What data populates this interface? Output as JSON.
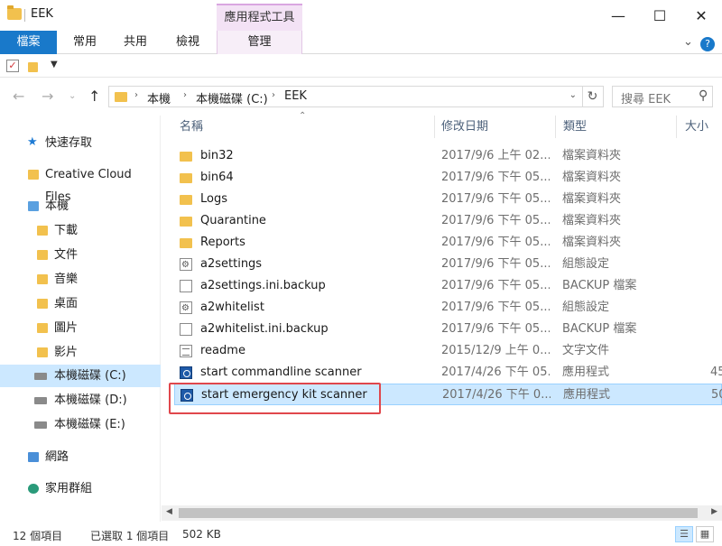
{
  "window": {
    "title": "EEK",
    "context_tools_label": "應用程式工具"
  },
  "ribbon": {
    "tabs": [
      "檔案",
      "常用",
      "共用",
      "檢視",
      "管理"
    ]
  },
  "address": {
    "crumbs": [
      "本機",
      "本機磁碟 (C:)",
      "EEK"
    ]
  },
  "search": {
    "placeholder": "搜尋 EEK"
  },
  "sidebar": {
    "items": [
      {
        "label": "快速存取",
        "icon": "star-icon"
      },
      {
        "label": "Creative Cloud Files",
        "icon": "creative-cloud-icon"
      },
      {
        "label": "本機",
        "icon": "computer-icon"
      },
      {
        "label": "下載",
        "icon": "downloads-icon"
      },
      {
        "label": "文件",
        "icon": "documents-icon"
      },
      {
        "label": "音樂",
        "icon": "music-icon"
      },
      {
        "label": "桌面",
        "icon": "desktop-icon"
      },
      {
        "label": "圖片",
        "icon": "pictures-icon"
      },
      {
        "label": "影片",
        "icon": "videos-icon"
      },
      {
        "label": "本機磁碟 (C:)",
        "icon": "drive-icon"
      },
      {
        "label": "本機磁碟 (D:)",
        "icon": "drive-icon"
      },
      {
        "label": "本機磁碟 (E:)",
        "icon": "drive-icon"
      },
      {
        "label": "網路",
        "icon": "network-icon"
      },
      {
        "label": "家用群組",
        "icon": "homegroup-icon"
      }
    ]
  },
  "columns": {
    "name": "名稱",
    "date": "修改日期",
    "type": "類型",
    "size": "大小"
  },
  "files": [
    {
      "name": "bin32",
      "date": "2017/9/6 上午 02...",
      "type": "檔案資料夾",
      "size": "",
      "icon": "folder"
    },
    {
      "name": "bin64",
      "date": "2017/9/6 下午 05...",
      "type": "檔案資料夾",
      "size": "",
      "icon": "folder"
    },
    {
      "name": "Logs",
      "date": "2017/9/6 下午 05...",
      "type": "檔案資料夾",
      "size": "",
      "icon": "folder"
    },
    {
      "name": "Quarantine",
      "date": "2017/9/6 下午 05...",
      "type": "檔案資料夾",
      "size": "",
      "icon": "folder"
    },
    {
      "name": "Reports",
      "date": "2017/9/6 下午 05...",
      "type": "檔案資料夾",
      "size": "",
      "icon": "folder"
    },
    {
      "name": "a2settings",
      "date": "2017/9/6 下午 05...",
      "type": "組態設定",
      "size": "",
      "icon": "cfg"
    },
    {
      "name": "a2settings.ini.backup",
      "date": "2017/9/6 下午 05...",
      "type": "BACKUP 檔案",
      "size": "",
      "icon": "file"
    },
    {
      "name": "a2whitelist",
      "date": "2017/9/6 下午 05...",
      "type": "組態設定",
      "size": "",
      "icon": "cfg"
    },
    {
      "name": "a2whitelist.ini.backup",
      "date": "2017/9/6 下午 05...",
      "type": "BACKUP 檔案",
      "size": "",
      "icon": "file"
    },
    {
      "name": "readme",
      "date": "2015/12/9 上午 0...",
      "type": "文字文件",
      "size": "",
      "icon": "txt"
    },
    {
      "name": "start commandline scanner",
      "date": "2017/4/26 下午 05...",
      "type": "應用程式",
      "size": "45",
      "icon": "app"
    },
    {
      "name": "start emergency kit scanner",
      "date": "2017/4/26 下午 0...",
      "type": "應用程式",
      "size": "50",
      "icon": "app"
    }
  ],
  "status": {
    "count": "12 個項目",
    "selected": "已選取 1 個項目",
    "size": "502 KB"
  }
}
